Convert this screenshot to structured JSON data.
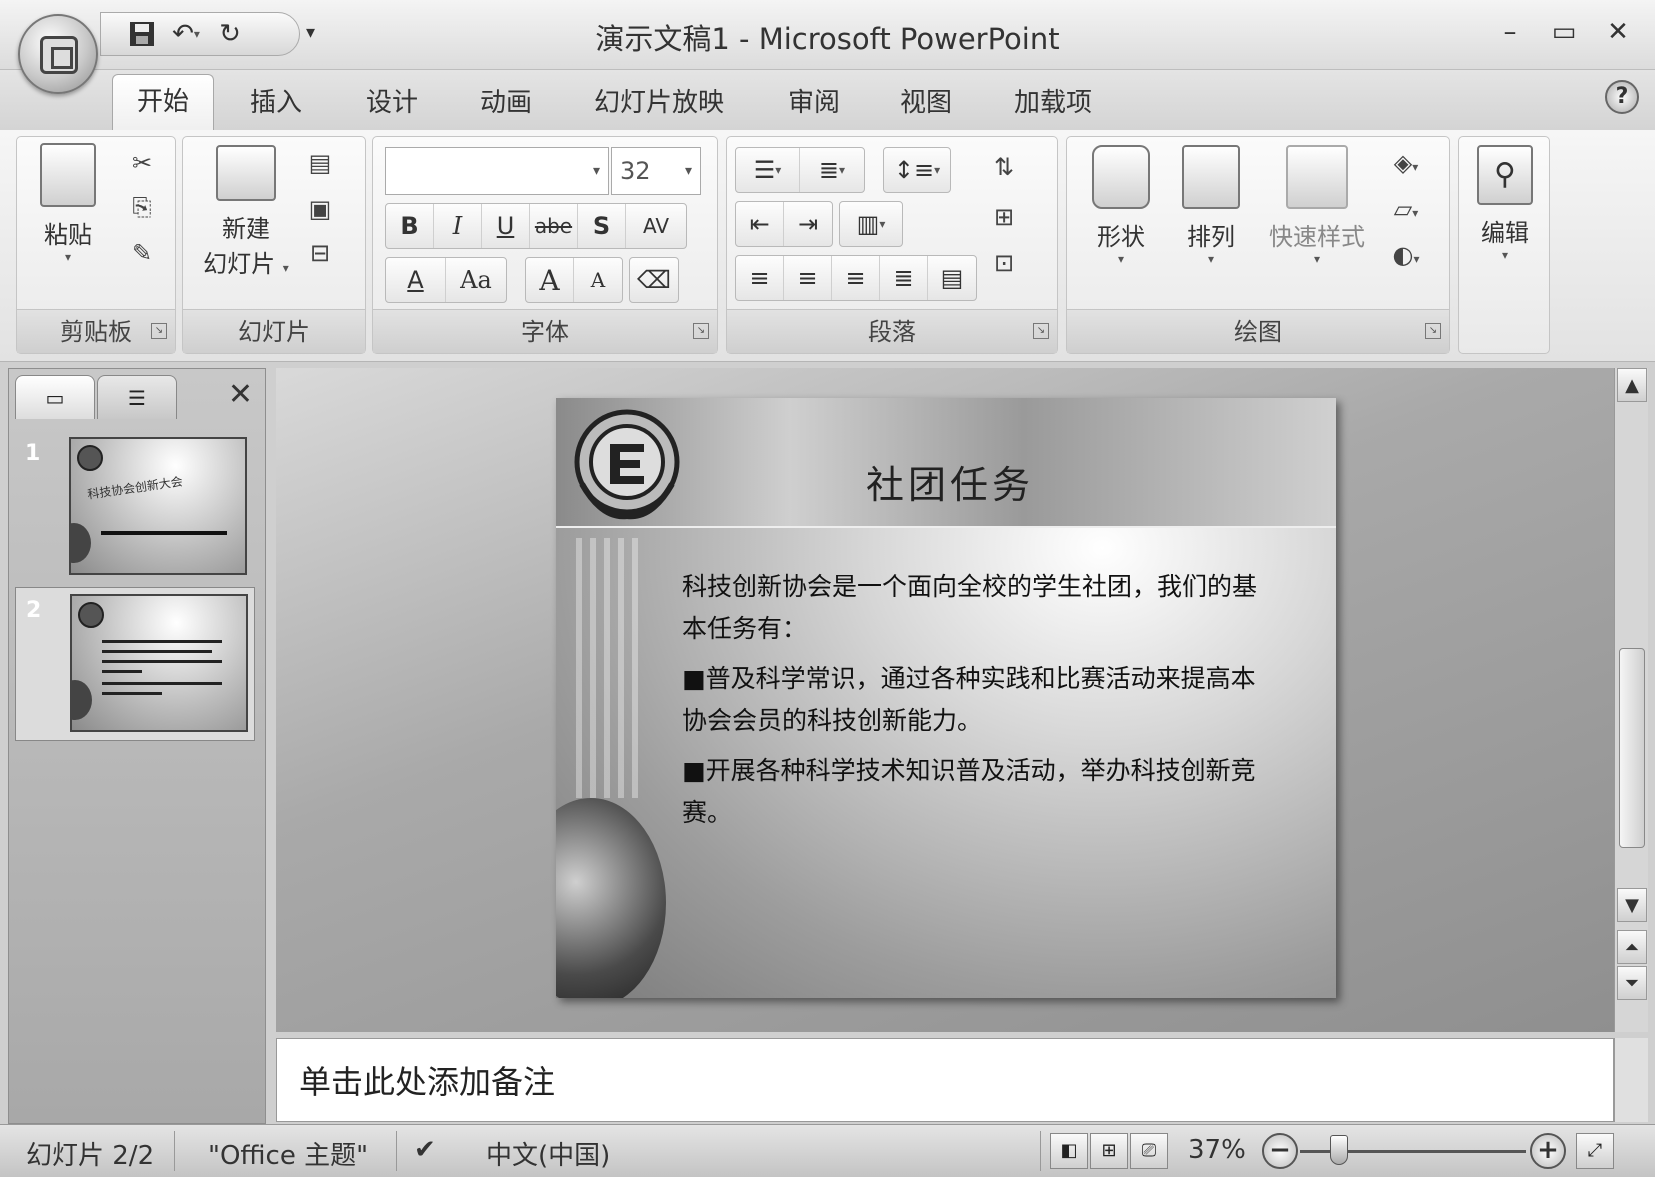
{
  "window": {
    "title": "演示文稿1 - Microsoft PowerPoint",
    "minimize_symbol": "–",
    "maximize_symbol": "▭",
    "close_symbol": "✕"
  },
  "quick_access": {
    "save_icon": "save-icon",
    "undo_icon": "undo-icon",
    "redo_icon": "redo-icon",
    "customize_icon": "customize-qat-icon"
  },
  "tabs": [
    {
      "label": "开始",
      "active": true
    },
    {
      "label": "插入"
    },
    {
      "label": "设计"
    },
    {
      "label": "动画"
    },
    {
      "label": "幻灯片放映"
    },
    {
      "label": "审阅"
    },
    {
      "label": "视图"
    },
    {
      "label": "加载项"
    }
  ],
  "ribbon": {
    "clipboard": {
      "group_label": "剪贴板",
      "paste_label": "粘贴"
    },
    "slides": {
      "group_label": "幻灯片",
      "new_slide_line1": "新建",
      "new_slide_line2": "幻灯片"
    },
    "font": {
      "group_label": "字体",
      "font_name": "",
      "font_size": "32",
      "bold": "B",
      "italic": "I",
      "underline": "U",
      "strike": "abe",
      "shadow": "S",
      "spacing": "AV",
      "font_color": "A",
      "change_case": "Aa",
      "grow": "A",
      "shrink": "A"
    },
    "paragraph": {
      "group_label": "段落"
    },
    "drawing": {
      "group_label": "绘图",
      "shapes_label": "形状",
      "arrange_label": "排列",
      "quick_styles_label": "快速样式"
    },
    "editing": {
      "label": "编辑"
    }
  },
  "slides_panel": {
    "slides": [
      {
        "number": "1",
        "title": "科技协会创新大会"
      },
      {
        "number": "2",
        "selected": true
      }
    ]
  },
  "slide": {
    "title": "社团任务",
    "body": [
      "科技创新协会是一个面向全校的学生社团，我们的基本任务有：",
      "■普及科学常识，通过各种实践和比赛活动来提高本协会会员的科技创新能力。",
      "■开展各种科学技术知识普及活动，举办科技创新竞赛。"
    ]
  },
  "notes": {
    "placeholder": "单击此处添加备注"
  },
  "status": {
    "slide_indicator": "幻灯片 2/2",
    "theme": "\"Office 主题\"",
    "language": "中文(中国)",
    "zoom": "37%",
    "zoom_level_fraction": 0.37
  }
}
